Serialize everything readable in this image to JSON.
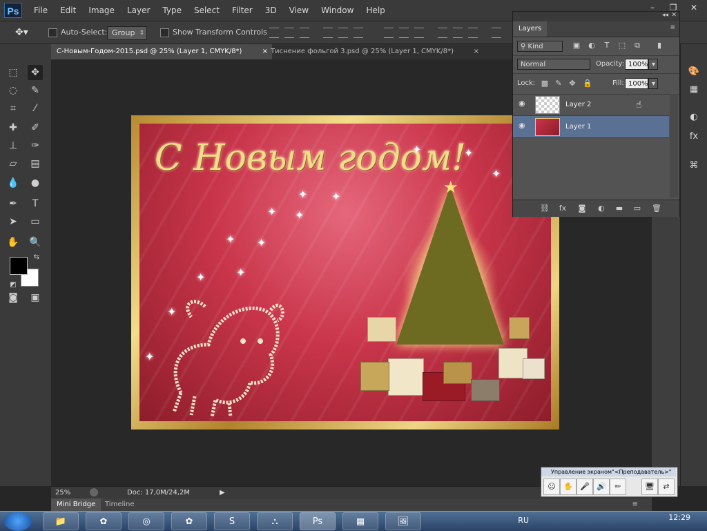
{
  "app": {
    "logo": "Ps",
    "window_controls": [
      "–",
      "❐",
      "✕"
    ]
  },
  "menu": [
    "File",
    "Edit",
    "Image",
    "Layer",
    "Type",
    "Select",
    "Filter",
    "3D",
    "View",
    "Window",
    "Help"
  ],
  "options_bar": {
    "auto_select_label": "Auto-Select:",
    "auto_select_value": "Group",
    "show_transform_label": "Show Transform Controls"
  },
  "tabs": [
    {
      "label": "С-Новым-Годом-2015.psd @ 25% (Layer 1, CMYK/8*)",
      "close": "×"
    },
    {
      "label": "Тиснение фольгой 3.psd @ 25% (Layer 1, CMYK/8*)",
      "close": "×"
    }
  ],
  "document": {
    "greeting": "С Новым годом!"
  },
  "layers_panel": {
    "title": "Layers",
    "filter_kind": "Kind",
    "blend_mode": "Normal",
    "opacity_label": "Opacity:",
    "opacity_value": "100%",
    "lock_label": "Lock:",
    "fill_label": "Fill:",
    "fill_value": "100%",
    "layers": [
      {
        "name": "Layer 2",
        "selected": false
      },
      {
        "name": "Layer 1",
        "selected": true
      }
    ],
    "footer_icons": [
      "link-icon",
      "fx-icon",
      "mask-icon",
      "adjustment-icon",
      "folder-icon",
      "new-layer-icon",
      "trash-icon"
    ]
  },
  "status_bar": {
    "zoom": "25%",
    "doc_info": "Doc: 17,0M/24,2M"
  },
  "bottom_tabs": [
    "Mini Bridge",
    "Timeline"
  ],
  "screen_control": {
    "title": "Управление экраном\"<Преподаватель>\""
  },
  "taskbar": {
    "language": "RU",
    "time": "12:29"
  },
  "colors": {
    "accent_selected_layer": "#5b7193",
    "card_red": "#c9354a",
    "gold": "#e9cd76"
  }
}
